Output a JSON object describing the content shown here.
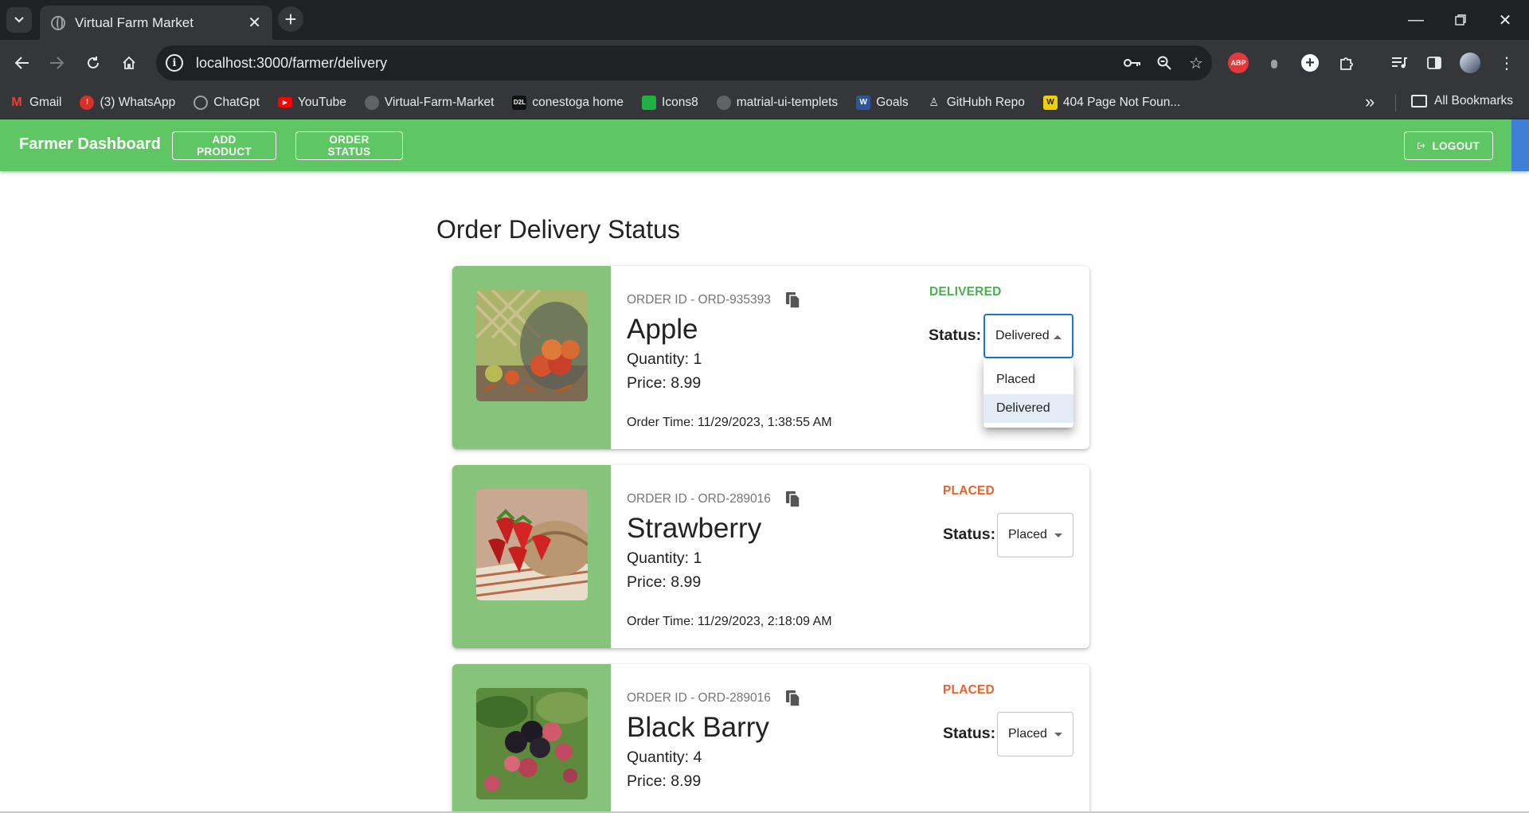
{
  "browser": {
    "tab_title": "Virtual Farm Market",
    "url": "localhost:3000/farmer/delivery",
    "bookmarks": [
      {
        "label": "Gmail",
        "icon": "gmail-icon",
        "color": "#ea4335"
      },
      {
        "label": "(3) WhatsApp",
        "icon": "whatsapp-icon",
        "color": "#d93025"
      },
      {
        "label": "ChatGpt",
        "icon": "chatgpt-icon",
        "color": "#9aa0a6"
      },
      {
        "label": "YouTube",
        "icon": "youtube-icon",
        "color": "#ff0000"
      },
      {
        "label": "Virtual-Farm-Market",
        "icon": "github-icon",
        "color": "#3c3c3c"
      },
      {
        "label": "conestoga home",
        "icon": "d2l-icon",
        "color": "#111111"
      },
      {
        "label": "Icons8",
        "icon": "icons8-icon",
        "color": "#1fb141"
      },
      {
        "label": "matrial-ui-templets",
        "icon": "github-icon",
        "color": "#3c3c3c"
      },
      {
        "label": "Goals",
        "icon": "word-icon",
        "color": "#2b579a"
      },
      {
        "label": "GitHubh Repo",
        "icon": "person-icon",
        "color": "#35363a"
      },
      {
        "label": "404 Page Not Foun...",
        "icon": "w-icon",
        "color": "#f0d000"
      }
    ],
    "all_bookmarks": "All Bookmarks",
    "abp_label": "ABP"
  },
  "app": {
    "brand": "Farmer Dashboard",
    "add_product": "ADD PRODUCT",
    "order_status": "ORDER STATUS",
    "logout": "LOGOUT",
    "brand_color": "#5ec763"
  },
  "page": {
    "title": "Order Delivery Status",
    "status_label": "Status:",
    "orders": [
      {
        "order_id": "ORDER ID - ORD-935393",
        "name": "Apple",
        "quantity": "Quantity: 1",
        "price": "Price: 8.99",
        "order_time": "Order Time: 11/29/2023, 1:38:55 AM",
        "badge": "DELIVERED",
        "badge_color": "#4caf50",
        "status": "Delivered"
      },
      {
        "order_id": "ORDER ID - ORD-289016",
        "name": "Strawberry",
        "quantity": "Quantity: 1",
        "price": "Price: 8.99",
        "order_time": "Order Time: 11/29/2023, 2:18:09 AM",
        "badge": "PLACED",
        "badge_color": "#e8632a",
        "status": "Placed"
      },
      {
        "order_id": "ORDER ID - ORD-289016",
        "name": "Black Barry",
        "quantity": "Quantity: 4",
        "price": "Price: 8.99",
        "order_time": "",
        "badge": "PLACED",
        "badge_color": "#e8632a",
        "status": "Placed"
      }
    ],
    "dropdown_options": [
      "Placed",
      "Delivered"
    ],
    "dropdown_selected": "Delivered"
  }
}
